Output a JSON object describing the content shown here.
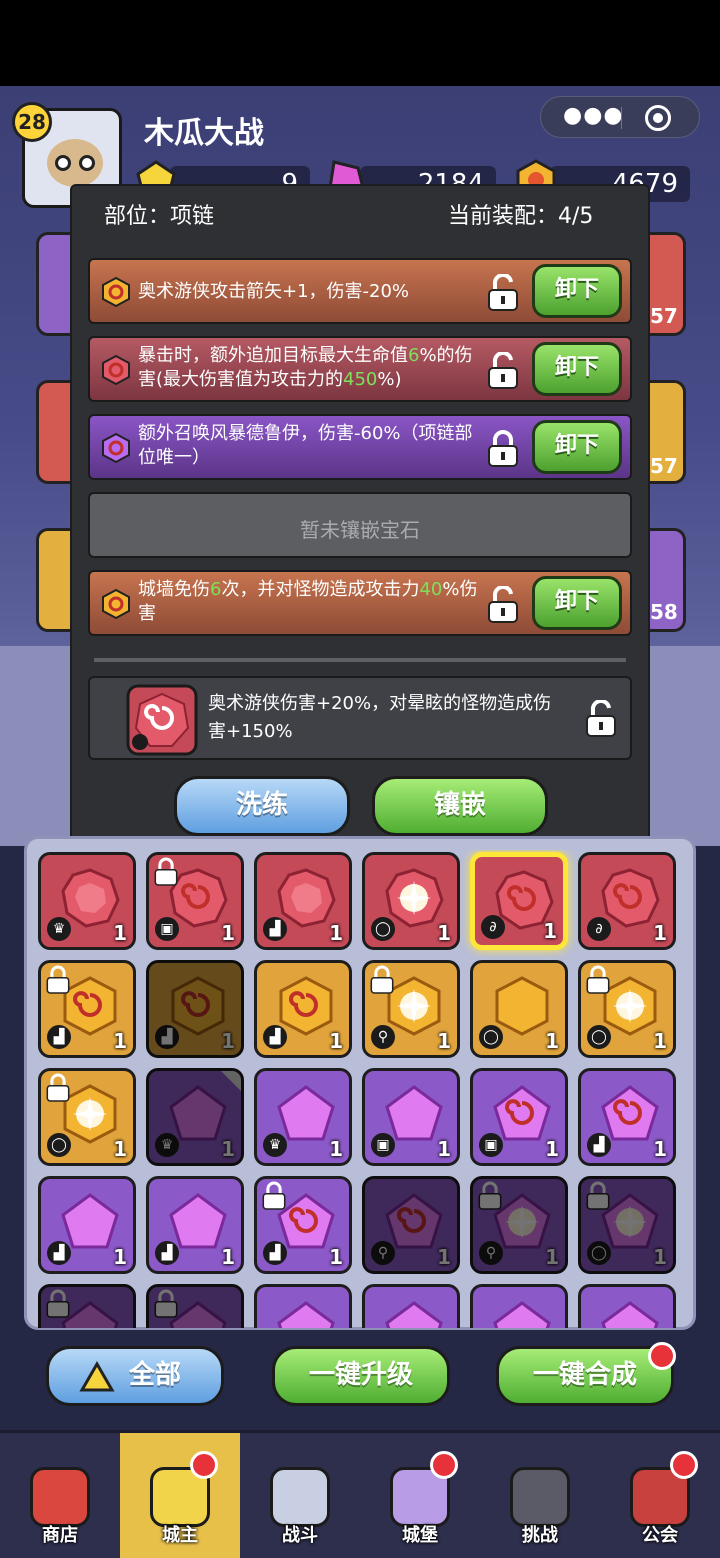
{
  "app": {
    "title": "木瓜大战",
    "level": "28"
  },
  "resources": {
    "gem_yellow": "9",
    "gem_pink": "2184",
    "gold": "4679"
  },
  "modal": {
    "position_label": "部位：项链",
    "equip_label": "当前装配：4/5",
    "rows": [
      {
        "parts": [
          {
            "t": "奥术游侠攻击箭矢+1，伤害-20%"
          }
        ],
        "unload": "卸下"
      },
      {
        "parts": [
          {
            "t": "暴击时，额外追加目标最大生命值"
          },
          {
            "t": "6",
            "h": true
          },
          {
            "t": "%的伤害(最大伤害值为攻击力的"
          },
          {
            "t": "450",
            "h": true
          },
          {
            "t": "%)"
          }
        ],
        "unload": "卸下"
      },
      {
        "parts": [
          {
            "t": "额外召唤风暴德鲁伊，伤害-60%（项链部位唯一）"
          }
        ],
        "unload": "卸下"
      },
      {
        "empty": "暂未镶嵌宝石"
      },
      {
        "parts": [
          {
            "t": "城墙免伤"
          },
          {
            "t": "6",
            "h": true
          },
          {
            "t": "次，并对怪物造成攻击力"
          },
          {
            "t": "40",
            "h": true
          },
          {
            "t": "%伤害"
          }
        ],
        "unload": "卸下"
      }
    ],
    "detail": "奥术游侠伤害+20%，对晕眩的怪物造成伤害+150%",
    "btn_wash": "洗练",
    "btn_inlay": "镶嵌"
  },
  "side_levels": [
    "57",
    "57",
    "58"
  ],
  "grid": [
    {
      "c": "red",
      "s": "round",
      "slot": "crown",
      "n": "1"
    },
    {
      "c": "red",
      "s": "swirl",
      "slot": "shirt",
      "n": "1",
      "lock": true
    },
    {
      "c": "red",
      "s": "round",
      "slot": "boot",
      "n": "1"
    },
    {
      "c": "red",
      "s": "burst",
      "slot": "ring",
      "n": "1"
    },
    {
      "c": "red",
      "s": "swirl",
      "slot": "neck",
      "n": "1",
      "sel": true
    },
    {
      "c": "red",
      "s": "swirl",
      "slot": "neck",
      "n": "1"
    },
    {
      "c": "orange",
      "s": "swirl",
      "slot": "boot",
      "n": "1",
      "lock": true
    },
    {
      "c": "orange",
      "s": "swirl",
      "slot": "boot",
      "n": "1",
      "dim": true
    },
    {
      "c": "orange",
      "s": "swirl",
      "slot": "boot",
      "n": "1"
    },
    {
      "c": "orange",
      "s": "burst",
      "slot": "staff",
      "n": "1",
      "lock": true
    },
    {
      "c": "orange",
      "s": "hex",
      "slot": "ring",
      "n": "1"
    },
    {
      "c": "orange",
      "s": "burst",
      "slot": "ring",
      "n": "1",
      "lock": true
    },
    {
      "c": "orange",
      "s": "burst",
      "slot": "ring",
      "n": "1",
      "lock": true
    },
    {
      "c": "purple",
      "s": "pent",
      "slot": "crown",
      "n": "1",
      "dim": true,
      "corner": true
    },
    {
      "c": "purple",
      "s": "pent",
      "slot": "crown",
      "n": "1"
    },
    {
      "c": "purple",
      "s": "pent",
      "slot": "shirt",
      "n": "1"
    },
    {
      "c": "purple",
      "s": "swirl",
      "slot": "shirt",
      "n": "1"
    },
    {
      "c": "purple",
      "s": "swirl",
      "slot": "boot",
      "n": "1"
    },
    {
      "c": "purple",
      "s": "pent",
      "slot": "boot",
      "n": "1"
    },
    {
      "c": "purple",
      "s": "pent",
      "slot": "boot",
      "n": "1"
    },
    {
      "c": "purple",
      "s": "swirl",
      "slot": "boot",
      "n": "1",
      "lock": true
    },
    {
      "c": "purple",
      "s": "swirl",
      "slot": "staff",
      "n": "1",
      "dim": true
    },
    {
      "c": "purple",
      "s": "burst",
      "slot": "staff",
      "n": "1",
      "dim": true,
      "lock": true
    },
    {
      "c": "purple",
      "s": "burst",
      "slot": "ring",
      "n": "1",
      "dim": true,
      "lock": true
    },
    {
      "c": "purple",
      "s": "pent",
      "slot": "",
      "n": "",
      "dim": true,
      "lock": true
    },
    {
      "c": "purple",
      "s": "pent",
      "slot": "",
      "n": "",
      "dim": true,
      "lock": true
    },
    {
      "c": "purple",
      "s": "pent",
      "slot": "",
      "n": ""
    },
    {
      "c": "purple",
      "s": "pent",
      "slot": "",
      "n": ""
    },
    {
      "c": "purple",
      "s": "pent",
      "slot": "",
      "n": ""
    },
    {
      "c": "purple",
      "s": "pent",
      "slot": "",
      "n": ""
    }
  ],
  "actions": {
    "all": "全部",
    "upgrade": "一键升级",
    "merge": "一键合成"
  },
  "nav": [
    {
      "label": "商店",
      "icon": "shop-icon",
      "color": "#d9473f",
      "dot": false
    },
    {
      "label": "城主",
      "icon": "crown-icon",
      "color": "#f1d44a",
      "dot": true,
      "active": true
    },
    {
      "label": "战斗",
      "icon": "swords-icon",
      "color": "#c9cfe3",
      "dot": false
    },
    {
      "label": "城堡",
      "icon": "castle-icon",
      "color": "#b99ce6",
      "dot": true
    },
    {
      "label": "挑战",
      "icon": "demon-icon",
      "color": "#5a5b66",
      "dot": false
    },
    {
      "label": "公会",
      "icon": "guild-book-icon",
      "color": "#c8413f",
      "dot": true
    }
  ],
  "colors": {
    "accent_green": "#7ee05a",
    "lock_white": "#ffffff"
  }
}
